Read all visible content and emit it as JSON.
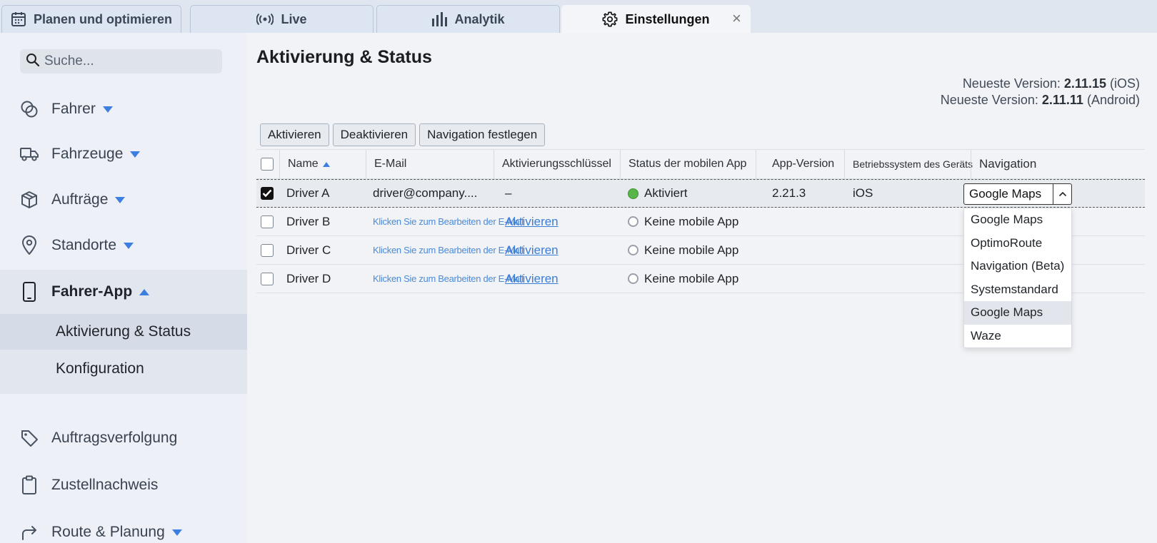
{
  "tabs": [
    {
      "label": "Planen und optimieren",
      "icon": "calendar-icon"
    },
    {
      "label": "Live",
      "icon": "broadcast-icon"
    },
    {
      "label": "Analytik",
      "icon": "bar-chart-icon"
    },
    {
      "label": "Einstellungen",
      "icon": "gear-icon",
      "active": true
    }
  ],
  "tab_close_label": "×",
  "sidebar": {
    "search_placeholder": "Suche...",
    "items": [
      {
        "label": "Fahrer",
        "icon": "drivers-icon"
      },
      {
        "label": "Fahrzeuge",
        "icon": "truck-icon"
      },
      {
        "label": "Aufträge",
        "icon": "box-icon"
      },
      {
        "label": "Standorte",
        "icon": "location-pin-icon"
      },
      {
        "label": "Fahrer-App",
        "icon": "smartphone-icon"
      },
      {
        "label": "Auftragsverfolgung",
        "icon": "tag-icon"
      },
      {
        "label": "Zustellnachweis",
        "icon": "clipboard-icon"
      },
      {
        "label": "Route & Planung",
        "icon": "route-arrow-icon"
      }
    ],
    "subitems": [
      {
        "label": "Aktivierung & Status",
        "active": true
      },
      {
        "label": "Konfiguration"
      }
    ]
  },
  "main": {
    "title": "Aktivierung & Status",
    "version_ios": {
      "prefix": "Neueste Version:",
      "number": "2.11.15",
      "platform": "(iOS)"
    },
    "version_android": {
      "prefix": "Neueste Version:",
      "number": "2.11.11",
      "platform": "(Android)"
    },
    "buttons": {
      "activate": "Aktivieren",
      "deactivate": "Deaktivieren",
      "set_navigation": "Navigation festlegen"
    }
  },
  "table": {
    "headers": {
      "name": "Name",
      "email": "E-Mail",
      "activation_key": "Aktivierungsschlüssel",
      "app_status": "Status der mobilen App",
      "app_version": "App-Version",
      "os": "Betriebssystem des Geräts",
      "navigation": "Navigation"
    },
    "rows": [
      {
        "name": "Driver A",
        "email": "driver@company....",
        "key": "–",
        "status": "Aktiviert",
        "version": "2.21.3",
        "os": "iOS",
        "checked": true
      },
      {
        "name": "Driver B",
        "email": "Klicken Sie zum Bearbeiten der E-Mail",
        "key": "Aktivieren",
        "status": "Keine mobile App",
        "version": "",
        "os": ""
      },
      {
        "name": "Driver C",
        "email": "Klicken Sie zum Bearbeiten der E-Mail",
        "key": "Aktivieren",
        "status": "Keine mobile App",
        "version": "",
        "os": ""
      },
      {
        "name": "Driver D",
        "email": "Klicken Sie zum Bearbeiten der E-Mail",
        "key": "Aktivieren",
        "status": "Keine mobile App",
        "version": "",
        "os": ""
      }
    ]
  },
  "navigation_select": {
    "value": "Google Maps",
    "options": [
      "Google Maps",
      "OptimoRoute",
      "Navigation (Beta)",
      "Systemstandard",
      "Google Maps",
      "Waze"
    ],
    "highlighted_index": 4
  },
  "colors": {
    "accent": "#3d7fe0",
    "status_active": "#57b54a",
    "sidebar_bg": "#edf1f7"
  }
}
